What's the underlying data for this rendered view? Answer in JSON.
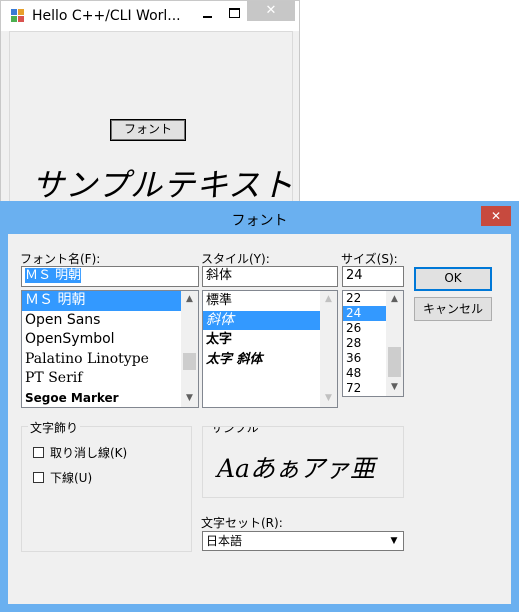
{
  "main_window": {
    "title": "Hello C++/CLI Worl...",
    "close_glyph": "✕",
    "font_button_label": "フォント",
    "sample_text": "サンプルテキスト"
  },
  "dialog": {
    "title": "フォント",
    "close_glyph": "✕",
    "font_name": {
      "label": "フォント名(F):",
      "value": "ＭＳ 明朝",
      "items": [
        "ＭＳ 明朝",
        "Open Sans",
        "OpenSymbol",
        "Palatino Linotype",
        "PT Serif",
        "Segoe Marker"
      ],
      "selected_index": 0
    },
    "style": {
      "label": "スタイル(Y):",
      "value": "斜体",
      "items": [
        "標準",
        "斜体",
        "太字",
        "太字 斜体"
      ],
      "selected_index": 1
    },
    "size": {
      "label": "サイズ(S):",
      "value": "24",
      "items": [
        "22",
        "24",
        "26",
        "28",
        "36",
        "48",
        "72"
      ],
      "selected_index": 1
    },
    "buttons": {
      "ok": "OK",
      "cancel": "キャンセル"
    },
    "effects": {
      "title": "文字飾り",
      "strikeout": "取り消し線(K)",
      "underline": "下線(U)",
      "strikeout_checked": false,
      "underline_checked": false
    },
    "sample": {
      "title": "サンプル",
      "text": "Aaあぁアァ亜"
    },
    "charset": {
      "label": "文字セット(R):",
      "value": "日本語"
    },
    "scroll_arrows": {
      "up": "▲",
      "down": "▼"
    }
  },
  "colors": {
    "dialog_frame": "#6ab0f0",
    "selection": "#3399ff",
    "close_button": "#c74a3e"
  }
}
